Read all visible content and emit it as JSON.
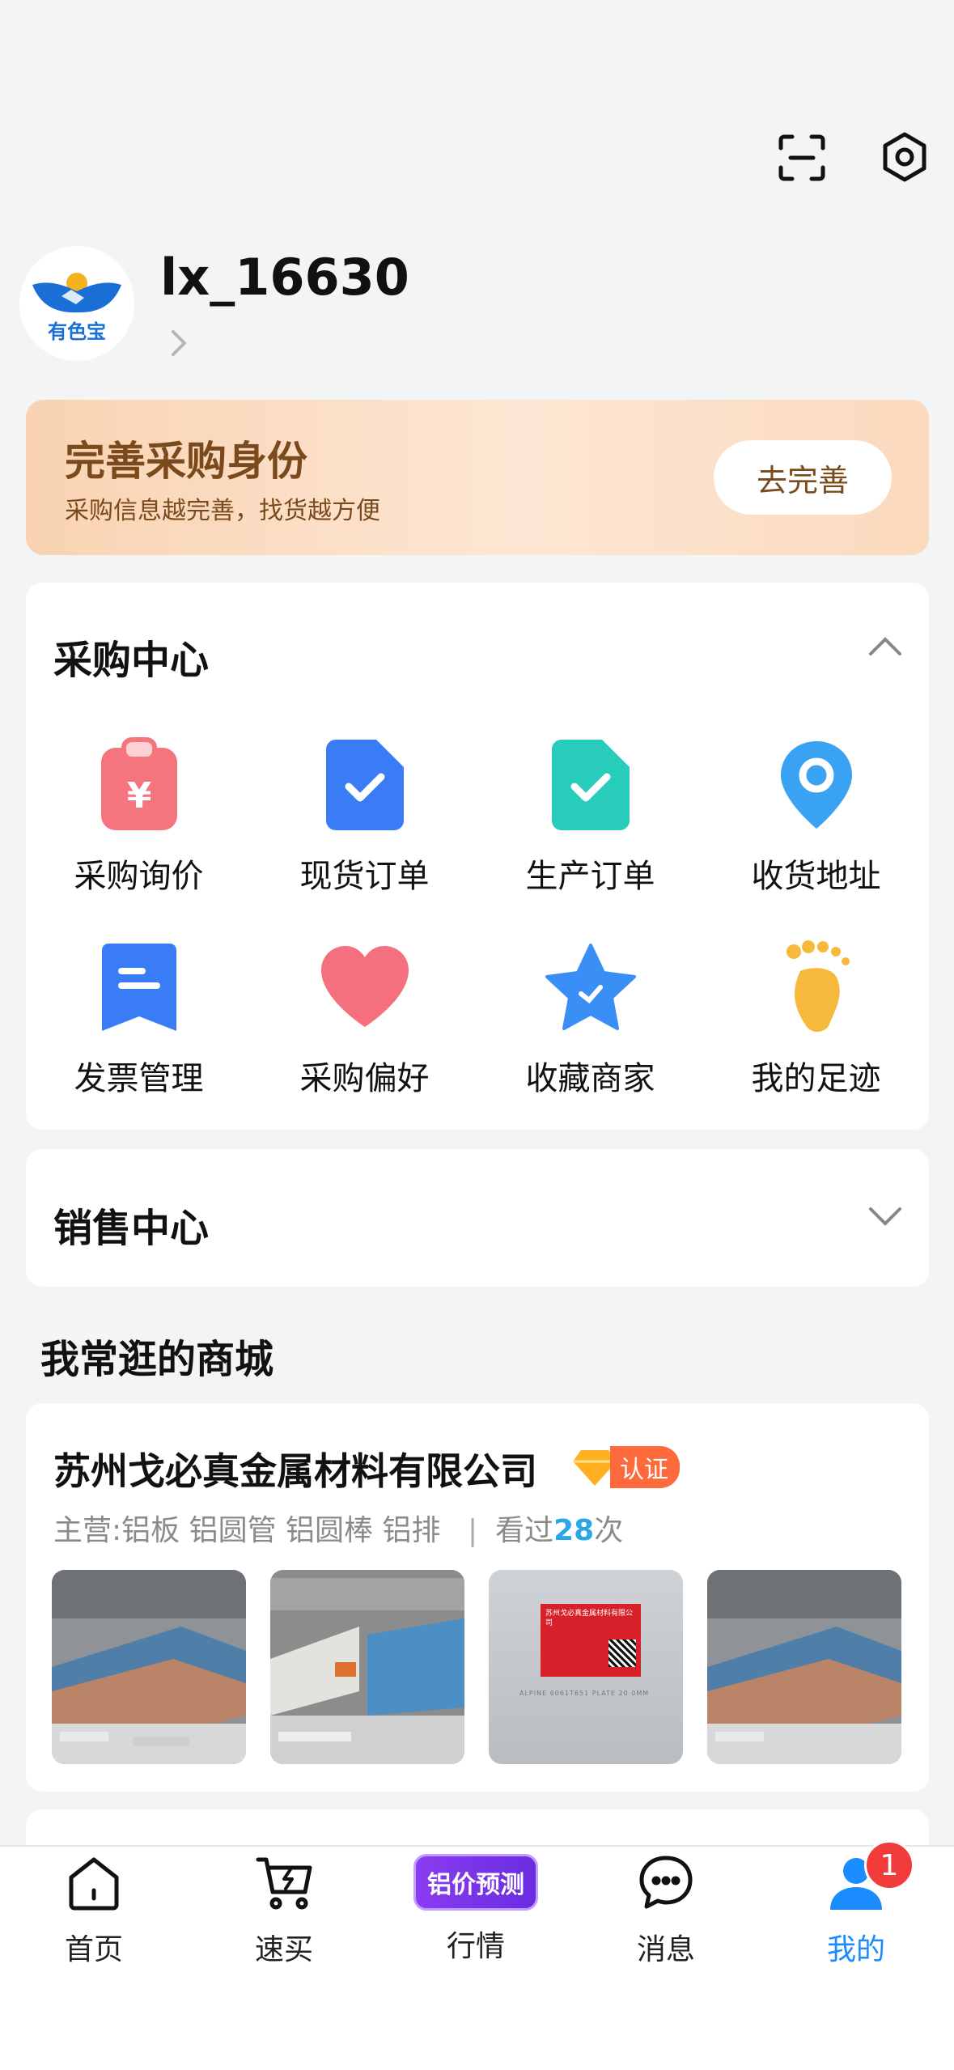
{
  "profile": {
    "username": "lx_16630",
    "avatar_text": "有色宝"
  },
  "promo": {
    "title": "完善采购身份",
    "subtitle": "采购信息越完善，找货越方便",
    "button": "去完善"
  },
  "purchase_center": {
    "title": "采购中心",
    "items": [
      {
        "label": "采购询价",
        "icon": "clipboard-yen-icon"
      },
      {
        "label": "现货订单",
        "icon": "document-check-icon"
      },
      {
        "label": "生产订单",
        "icon": "document-check-icon"
      },
      {
        "label": "收货地址",
        "icon": "location-pin-icon"
      },
      {
        "label": "发票管理",
        "icon": "invoice-icon"
      },
      {
        "label": "采购偏好",
        "icon": "heart-icon"
      },
      {
        "label": "收藏商家",
        "icon": "star-icon"
      },
      {
        "label": "我的足迹",
        "icon": "footprint-icon"
      }
    ]
  },
  "sales_center": {
    "title": "销售中心"
  },
  "favorite_shops": {
    "title": "我常逛的商城",
    "shop": {
      "name": "苏州戈必真金属材料有限公司",
      "badge": "认证",
      "main_label": "主营:",
      "main_products": "铝板 铝圆管 铝圆棒 铝排",
      "separator": "|",
      "viewed_prefix": "看过",
      "viewed_count": "28",
      "viewed_suffix": "次",
      "photo3_sign": "苏州戈必真金属材料有限公司",
      "photo3_plate": "ALPINE 6061T651 PLATE 20.0MM"
    }
  },
  "tabbar": {
    "items": [
      {
        "label": "首页",
        "icon": "home-icon"
      },
      {
        "label": "速买",
        "icon": "cart-icon"
      },
      {
        "label": "行情",
        "icon": "price-forecast-badge",
        "badge_text": "铝价预测"
      },
      {
        "label": "消息",
        "icon": "chat-icon"
      },
      {
        "label": "我的",
        "icon": "user-icon",
        "notification_count": "1"
      }
    ]
  },
  "colors": {
    "accent_blue": "#1a8cff",
    "promo_text": "#7a4a1c",
    "badge_orange": "#ff6a3d",
    "count_blue": "#2aa7e6"
  }
}
